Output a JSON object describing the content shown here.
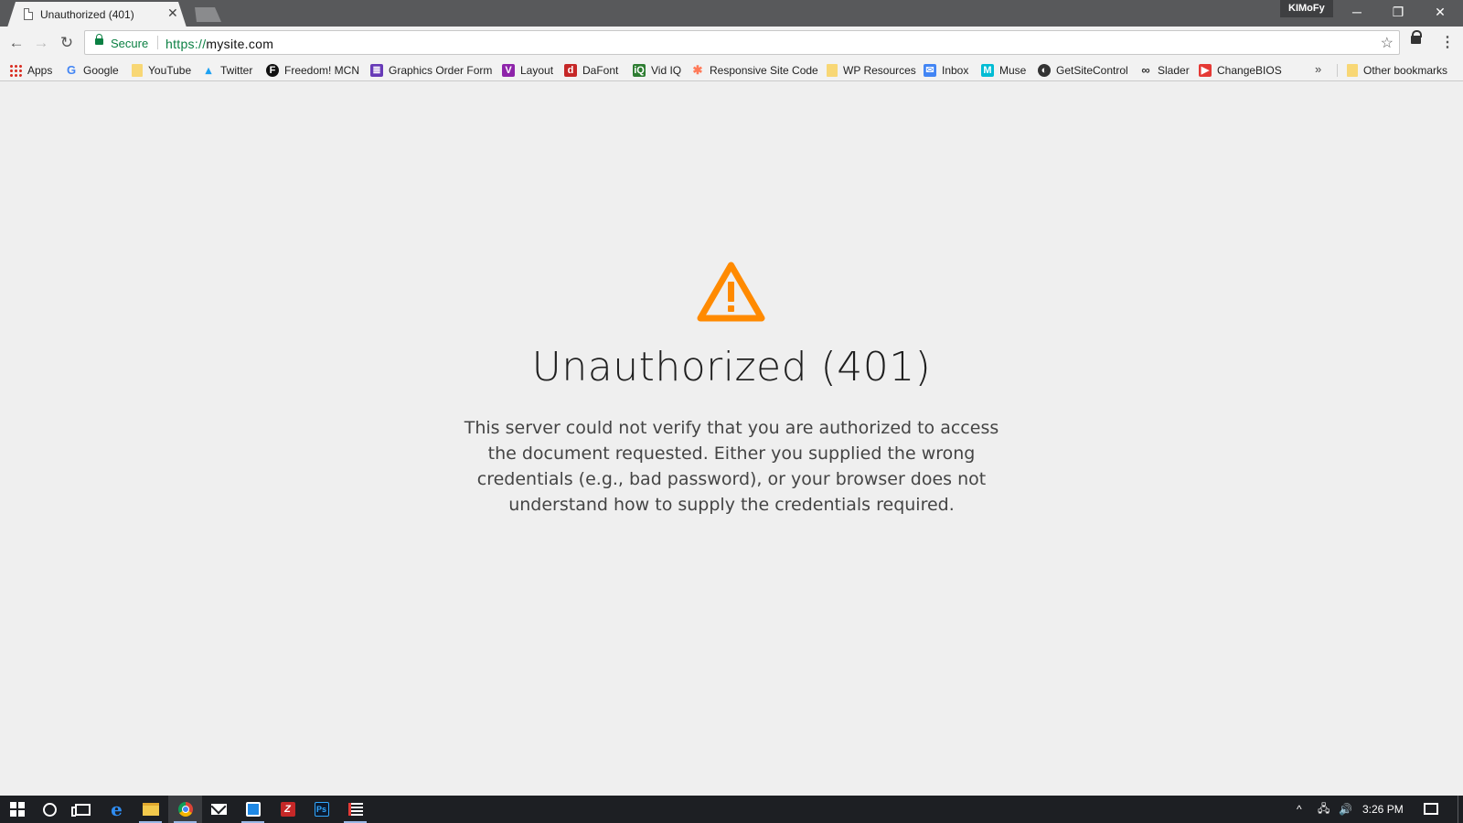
{
  "browser": {
    "tab": {
      "title": "Unauthorized (401)",
      "close_glyph": "✕"
    },
    "profile_name": "KIMoFy",
    "window_controls": {
      "minimize": "─",
      "restore": "❐",
      "close": "✕"
    },
    "toolbar": {
      "back": "←",
      "forward": "→",
      "reload": "↻",
      "secure_label": "Secure",
      "url_scheme": "https://",
      "url_host": "mysite.com",
      "star": "☆",
      "menu": "⋮"
    },
    "bookmarks": [
      {
        "label": "Apps",
        "icon": "apps-grid-icon"
      },
      {
        "label": "Google",
        "icon": "google-icon",
        "glyph": "G"
      },
      {
        "label": "YouTube",
        "icon": "folder-icon"
      },
      {
        "label": "Twitter",
        "icon": "twitter-icon",
        "glyph": "🐦"
      },
      {
        "label": "Freedom! MCN",
        "icon": "freedom-icon",
        "glyph": "F",
        "color": "#111111"
      },
      {
        "label": "Graphics Order Form",
        "icon": "form-icon",
        "glyph": "≣",
        "color": "#673ab7"
      },
      {
        "label": "Layout",
        "icon": "layout-icon",
        "glyph": "V",
        "color": "#8e24aa"
      },
      {
        "label": "DaFont",
        "icon": "dafont-icon",
        "glyph": "d",
        "color": "#c62828"
      },
      {
        "label": "Vid IQ",
        "icon": "vidiq-icon",
        "glyph": "iQ",
        "color": "#2e7d32"
      },
      {
        "label": "Responsive Site Code",
        "icon": "hubspot-icon",
        "glyph": "✱",
        "color": "#ff7a59"
      },
      {
        "label": "WP Resources",
        "icon": "folder-icon"
      },
      {
        "label": "Inbox",
        "icon": "inbox-icon",
        "glyph": "✉",
        "color": "#4285f4"
      },
      {
        "label": "Muse",
        "icon": "muse-icon",
        "glyph": "M",
        "color": "#00bcd4"
      },
      {
        "label": "GetSiteControl",
        "icon": "getsitecontrol-icon",
        "glyph": "◐",
        "color": "#333333"
      },
      {
        "label": "Slader",
        "icon": "slader-icon",
        "glyph": "∞",
        "color": "#333333"
      },
      {
        "label": "ChangeBIOS",
        "icon": "youtube-icon",
        "glyph": "▶",
        "color": "#e53935"
      }
    ],
    "bookmarks_overflow": "»",
    "other_bookmarks": "Other bookmarks"
  },
  "page": {
    "title": "Unauthorized (401)",
    "body": "This server could not verify that you are authorized to access the document requested. Either you supplied the wrong credentials (e.g., bad password), or your browser does not understand how to supply the credentials required.",
    "warning_color": "#ff8a00"
  },
  "taskbar": {
    "apps": [
      {
        "name": "start-button",
        "icon": "windows-logo-icon"
      },
      {
        "name": "cortana-button",
        "icon": "cortana-icon"
      },
      {
        "name": "task-view-button",
        "icon": "task-view-icon"
      },
      {
        "name": "edge-app",
        "icon": "edge-icon"
      },
      {
        "name": "file-explorer-app",
        "icon": "folder-icon"
      },
      {
        "name": "chrome-app",
        "icon": "chrome-icon"
      },
      {
        "name": "mail-app",
        "icon": "mail-icon"
      },
      {
        "name": "notepad-app",
        "icon": "notepad-icon"
      },
      {
        "name": "filezilla-app",
        "icon": "filezilla-icon",
        "glyph": "Z"
      },
      {
        "name": "photoshop-app",
        "icon": "photoshop-icon",
        "glyph": "Ps"
      },
      {
        "name": "list-app",
        "icon": "list-icon"
      }
    ],
    "tray": {
      "chevron": "^",
      "network": "🖧",
      "volume": "🔊"
    },
    "clock": "3:26 PM"
  }
}
